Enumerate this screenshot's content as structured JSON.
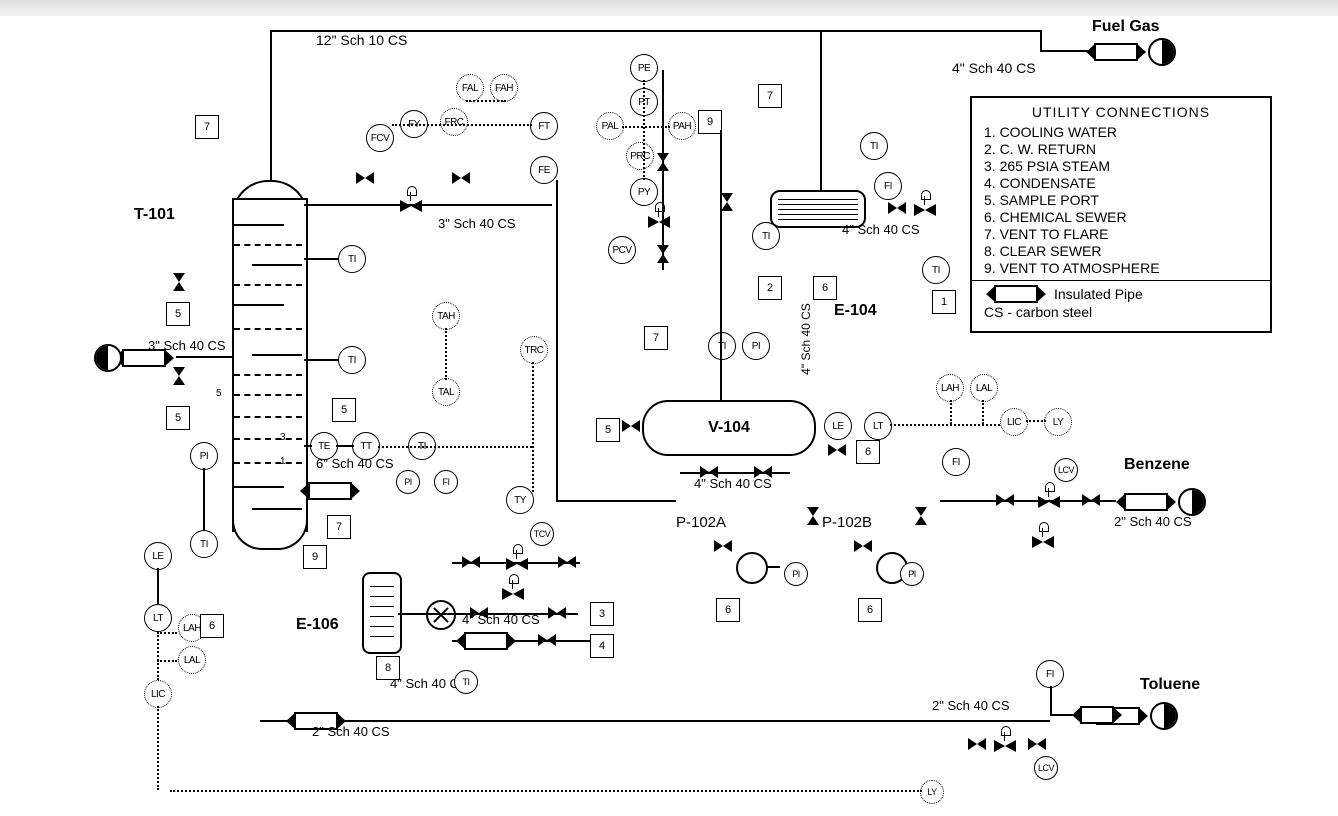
{
  "streams": {
    "fuel_gas": "Fuel Gas",
    "benzene": "Benzene",
    "toluene": "Toluene"
  },
  "pipe_specs": {
    "top": "12\" Sch 10  CS",
    "overhead": "4\" Sch 40 CS",
    "feed": "3\" Sch 40 CS",
    "reflux": "3\" Sch 40 CS",
    "side": "6\" Sch 40 CS",
    "e104_in": "4\" Sch 40 CS",
    "v104_vert": "4\" Sch 40 CS",
    "v104_out": "4\" Sch 40 CS",
    "reboiler": "4\" Sch 40 CS",
    "bottoms": "2\" Sch 40 CS",
    "toluene": "2\" Sch 40 CS",
    "benzene": "2\" Sch 40 CS"
  },
  "equipment": {
    "t101": "T-101",
    "e106": "E-106",
    "e104": "E-104",
    "v104": "V-104",
    "p102a": "P-102A",
    "p102b": "P-102B"
  },
  "instr": {
    "FCV": "FCV",
    "FY": "FY",
    "FRC": "FRC",
    "FAL": "FAL",
    "FAH": "FAH",
    "FT": "FT",
    "FE": "FE",
    "PE": "PE",
    "PT": "PT",
    "PAL": "PAL",
    "PAH": "PAH",
    "PRC": "PRC",
    "PY": "PY",
    "PCV": "PCV",
    "TI": "TI",
    "TE": "TE",
    "TT": "TT",
    "TAH": "TAH",
    "TAL": "TAL",
    "TRC": "TRC",
    "TY": "TY",
    "TCV": "TCV",
    "FI": "FI",
    "PI": "PI",
    "LE": "LE",
    "LT": "LT",
    "LAH": "LAH",
    "LAL": "LAL",
    "LIC": "LIC",
    "LY": "LY",
    "LCV": "LCV"
  },
  "util_nums": {
    "1": "1",
    "2": "2",
    "3": "3",
    "4": "4",
    "5": "5",
    "6": "6",
    "7": "7",
    "8": "8",
    "9": "9"
  },
  "legend": {
    "title": "UTILITY CONNECTIONS",
    "items": [
      "1.  COOLING  WATER",
      "2.  C.  W.  RETURN",
      "3.  265  PSIA  STEAM",
      "4.  CONDENSATE",
      "5.  SAMPLE  PORT",
      "6.  CHEMICAL  SEWER",
      "7.  VENT  TO  FLARE",
      "8.  CLEAR  SEWER",
      "9.  VENT  TO  ATMOSPHERE"
    ],
    "ins": "Insulated Pipe",
    "cs": "CS - carbon steel"
  }
}
